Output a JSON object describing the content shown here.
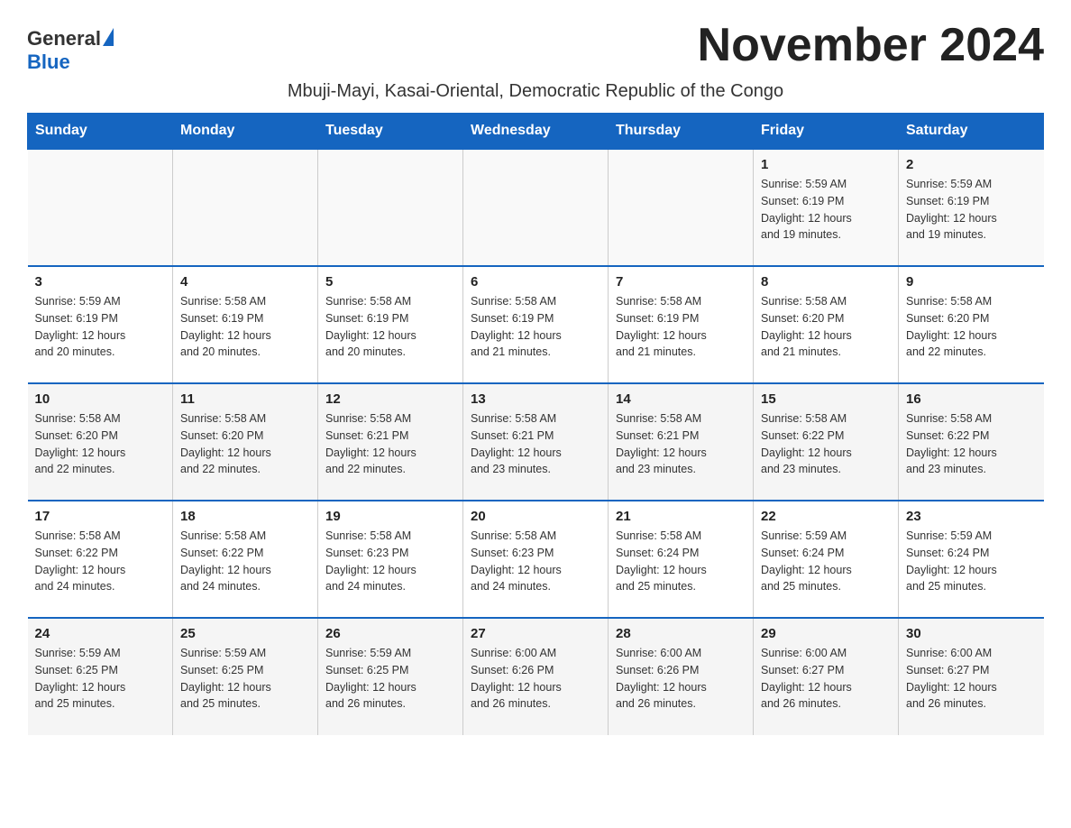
{
  "header": {
    "logo_general": "General",
    "logo_blue": "Blue",
    "month_title": "November 2024",
    "location": "Mbuji-Mayi, Kasai-Oriental, Democratic Republic of the Congo"
  },
  "days_of_week": [
    "Sunday",
    "Monday",
    "Tuesday",
    "Wednesday",
    "Thursday",
    "Friday",
    "Saturday"
  ],
  "weeks": [
    {
      "days": [
        {
          "number": "",
          "info": ""
        },
        {
          "number": "",
          "info": ""
        },
        {
          "number": "",
          "info": ""
        },
        {
          "number": "",
          "info": ""
        },
        {
          "number": "",
          "info": ""
        },
        {
          "number": "1",
          "info": "Sunrise: 5:59 AM\nSunset: 6:19 PM\nDaylight: 12 hours\nand 19 minutes."
        },
        {
          "number": "2",
          "info": "Sunrise: 5:59 AM\nSunset: 6:19 PM\nDaylight: 12 hours\nand 19 minutes."
        }
      ]
    },
    {
      "days": [
        {
          "number": "3",
          "info": "Sunrise: 5:59 AM\nSunset: 6:19 PM\nDaylight: 12 hours\nand 20 minutes."
        },
        {
          "number": "4",
          "info": "Sunrise: 5:58 AM\nSunset: 6:19 PM\nDaylight: 12 hours\nand 20 minutes."
        },
        {
          "number": "5",
          "info": "Sunrise: 5:58 AM\nSunset: 6:19 PM\nDaylight: 12 hours\nand 20 minutes."
        },
        {
          "number": "6",
          "info": "Sunrise: 5:58 AM\nSunset: 6:19 PM\nDaylight: 12 hours\nand 21 minutes."
        },
        {
          "number": "7",
          "info": "Sunrise: 5:58 AM\nSunset: 6:19 PM\nDaylight: 12 hours\nand 21 minutes."
        },
        {
          "number": "8",
          "info": "Sunrise: 5:58 AM\nSunset: 6:20 PM\nDaylight: 12 hours\nand 21 minutes."
        },
        {
          "number": "9",
          "info": "Sunrise: 5:58 AM\nSunset: 6:20 PM\nDaylight: 12 hours\nand 22 minutes."
        }
      ]
    },
    {
      "days": [
        {
          "number": "10",
          "info": "Sunrise: 5:58 AM\nSunset: 6:20 PM\nDaylight: 12 hours\nand 22 minutes."
        },
        {
          "number": "11",
          "info": "Sunrise: 5:58 AM\nSunset: 6:20 PM\nDaylight: 12 hours\nand 22 minutes."
        },
        {
          "number": "12",
          "info": "Sunrise: 5:58 AM\nSunset: 6:21 PM\nDaylight: 12 hours\nand 22 minutes."
        },
        {
          "number": "13",
          "info": "Sunrise: 5:58 AM\nSunset: 6:21 PM\nDaylight: 12 hours\nand 23 minutes."
        },
        {
          "number": "14",
          "info": "Sunrise: 5:58 AM\nSunset: 6:21 PM\nDaylight: 12 hours\nand 23 minutes."
        },
        {
          "number": "15",
          "info": "Sunrise: 5:58 AM\nSunset: 6:22 PM\nDaylight: 12 hours\nand 23 minutes."
        },
        {
          "number": "16",
          "info": "Sunrise: 5:58 AM\nSunset: 6:22 PM\nDaylight: 12 hours\nand 23 minutes."
        }
      ]
    },
    {
      "days": [
        {
          "number": "17",
          "info": "Sunrise: 5:58 AM\nSunset: 6:22 PM\nDaylight: 12 hours\nand 24 minutes."
        },
        {
          "number": "18",
          "info": "Sunrise: 5:58 AM\nSunset: 6:22 PM\nDaylight: 12 hours\nand 24 minutes."
        },
        {
          "number": "19",
          "info": "Sunrise: 5:58 AM\nSunset: 6:23 PM\nDaylight: 12 hours\nand 24 minutes."
        },
        {
          "number": "20",
          "info": "Sunrise: 5:58 AM\nSunset: 6:23 PM\nDaylight: 12 hours\nand 24 minutes."
        },
        {
          "number": "21",
          "info": "Sunrise: 5:58 AM\nSunset: 6:24 PM\nDaylight: 12 hours\nand 25 minutes."
        },
        {
          "number": "22",
          "info": "Sunrise: 5:59 AM\nSunset: 6:24 PM\nDaylight: 12 hours\nand 25 minutes."
        },
        {
          "number": "23",
          "info": "Sunrise: 5:59 AM\nSunset: 6:24 PM\nDaylight: 12 hours\nand 25 minutes."
        }
      ]
    },
    {
      "days": [
        {
          "number": "24",
          "info": "Sunrise: 5:59 AM\nSunset: 6:25 PM\nDaylight: 12 hours\nand 25 minutes."
        },
        {
          "number": "25",
          "info": "Sunrise: 5:59 AM\nSunset: 6:25 PM\nDaylight: 12 hours\nand 25 minutes."
        },
        {
          "number": "26",
          "info": "Sunrise: 5:59 AM\nSunset: 6:25 PM\nDaylight: 12 hours\nand 26 minutes."
        },
        {
          "number": "27",
          "info": "Sunrise: 6:00 AM\nSunset: 6:26 PM\nDaylight: 12 hours\nand 26 minutes."
        },
        {
          "number": "28",
          "info": "Sunrise: 6:00 AM\nSunset: 6:26 PM\nDaylight: 12 hours\nand 26 minutes."
        },
        {
          "number": "29",
          "info": "Sunrise: 6:00 AM\nSunset: 6:27 PM\nDaylight: 12 hours\nand 26 minutes."
        },
        {
          "number": "30",
          "info": "Sunrise: 6:00 AM\nSunset: 6:27 PM\nDaylight: 12 hours\nand 26 minutes."
        }
      ]
    }
  ]
}
